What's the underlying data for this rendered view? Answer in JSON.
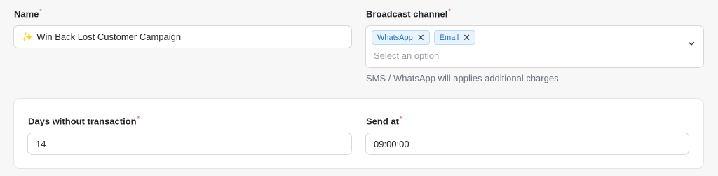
{
  "name_field": {
    "label": "Name",
    "required_mark": "*",
    "value": "Win Back Lost Customer Campaign",
    "prefix_icon": "sparkles-icon"
  },
  "broadcast_channel": {
    "label": "Broadcast channel",
    "required_mark": "*",
    "selected": [
      {
        "label": "WhatsApp",
        "remove_glyph": "✕"
      },
      {
        "label": "Email",
        "remove_glyph": "✕"
      }
    ],
    "placeholder": "Select an option",
    "hint": "SMS / WhatsApp will applies additional charges"
  },
  "settings_card": {
    "days_field": {
      "label": "Days without transaction",
      "required_mark": "*",
      "value": "14"
    },
    "send_at_field": {
      "label": "Send at",
      "required_mark": "*",
      "value": "09:00:00"
    }
  },
  "colors": {
    "required": "#e5484d",
    "chip_bg": "#e8f3fd",
    "chip_text": "#1c6fb5",
    "page_bg": "#f7f7f8"
  }
}
